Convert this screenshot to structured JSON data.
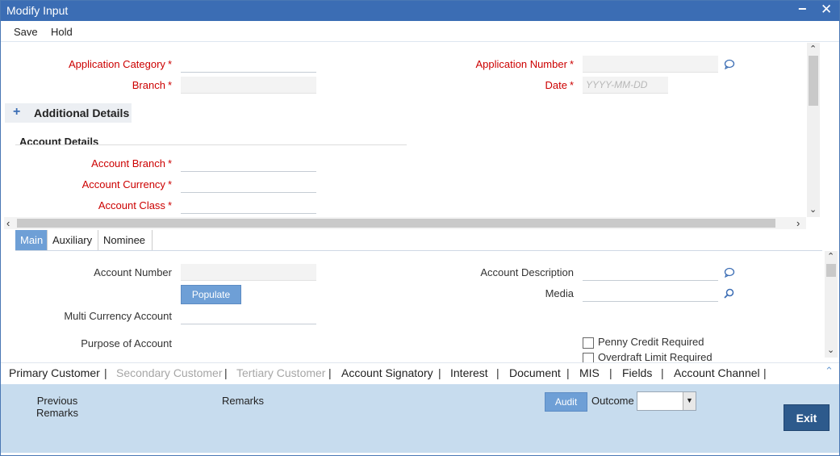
{
  "window": {
    "title": "Modify Input",
    "minimize": "−",
    "close": "✕"
  },
  "menu": {
    "save": "Save",
    "hold": "Hold"
  },
  "header": {
    "application_category": "Application Category",
    "branch": "Branch",
    "application_number": "Application Number",
    "date": "Date",
    "date_placeholder": "YYYY-MM-DD",
    "required_mark": "*"
  },
  "additional_details": {
    "toggle": "+",
    "label": "Additional Details"
  },
  "account_details": {
    "heading": "Account Details",
    "account_branch": "Account Branch",
    "account_currency": "Account Currency",
    "account_class": "Account Class"
  },
  "tabs": [
    {
      "label": "Main",
      "active": true
    },
    {
      "label": "Auxiliary",
      "active": false
    },
    {
      "label": "Nominee",
      "active": false
    }
  ],
  "main_tab": {
    "account_number": "Account Number",
    "populate_button": "Populate",
    "multi_currency_account": "Multi Currency Account",
    "purpose_of_account": "Purpose of Account",
    "account_description": "Account Description",
    "media": "Media",
    "penny_credit_required": "Penny Credit Required",
    "overdraft_limit_required": "Overdraft Limit Required"
  },
  "links": [
    {
      "label": "Primary Customer",
      "enabled": true
    },
    {
      "label": "Secondary Customer",
      "enabled": false
    },
    {
      "label": "Tertiary Customer",
      "enabled": false
    },
    {
      "label": "Account Signatory",
      "enabled": true
    },
    {
      "label": "Interest",
      "enabled": true
    },
    {
      "label": "Document",
      "enabled": true
    },
    {
      "label": "MIS",
      "enabled": true
    },
    {
      "label": "Fields",
      "enabled": true
    },
    {
      "label": "Account Channel",
      "enabled": true
    }
  ],
  "link_separator": "|",
  "footer": {
    "previous_remarks_line1": "Previous",
    "previous_remarks_line2": "Remarks",
    "remarks": "Remarks",
    "audit_button": "Audit",
    "outcome": "Outcome",
    "outcome_value": "",
    "exit_button": "Exit"
  },
  "colors": {
    "title_bar": "#3b6db4",
    "required": "#cc0000",
    "footer_bg": "#c7dcee",
    "accent_button": "#6e9fd6",
    "exit_button": "#2d5a8c"
  }
}
